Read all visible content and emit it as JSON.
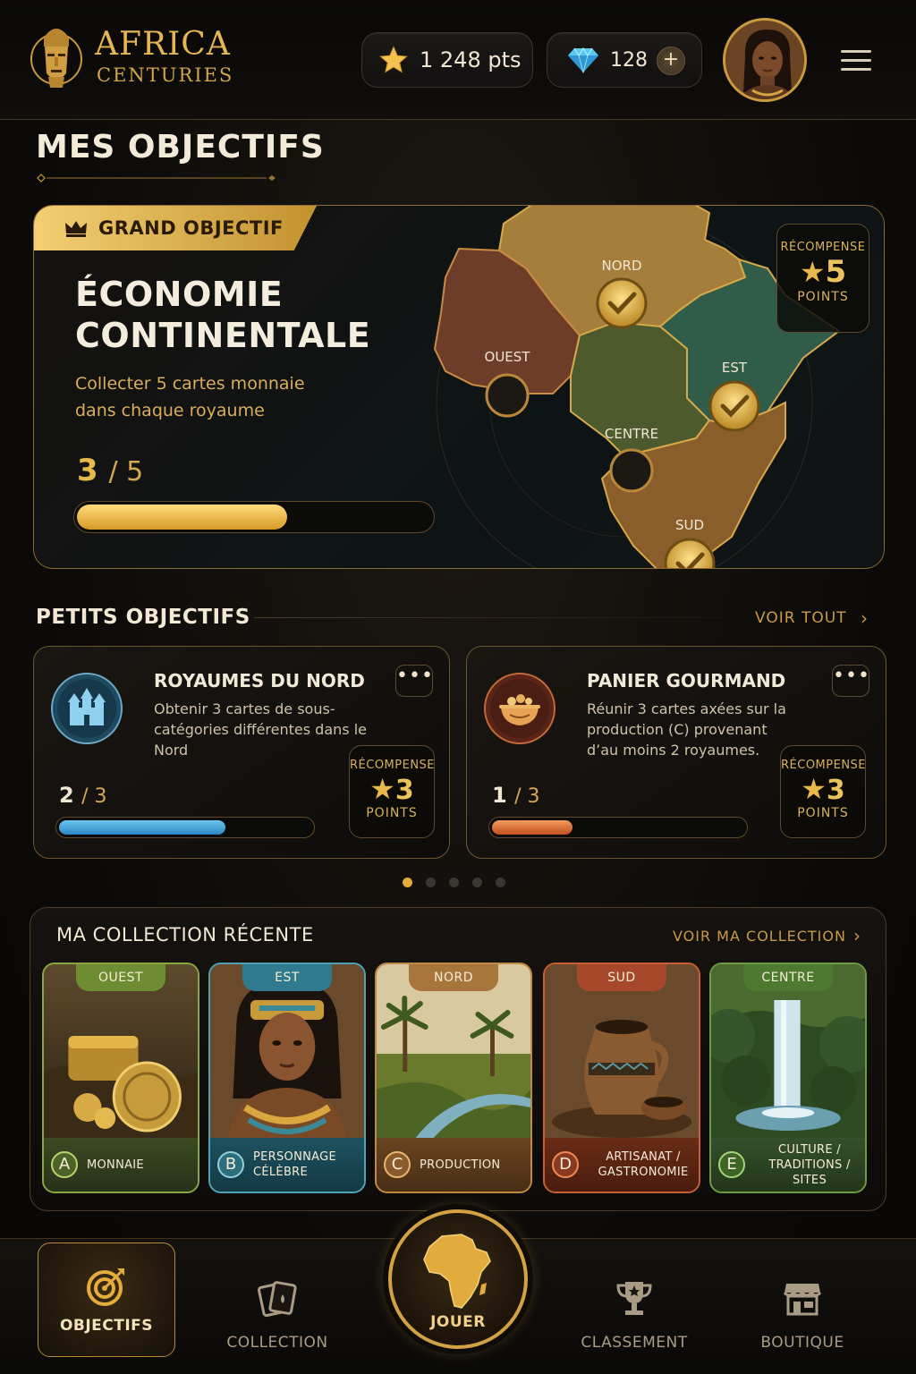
{
  "header": {
    "logo_title": "AFRICA",
    "logo_sub": "CENTURIES",
    "points": "1 248 pts",
    "gems": "128",
    "gem_add": "+",
    "icons": {
      "points": "star-icon",
      "gems": "diamond-icon",
      "menu": "hamburger-menu-icon"
    }
  },
  "page_title": "MES OBJECTIFS",
  "grand": {
    "badge": "GRAND OBJECTIF",
    "title": "ÉCONOMIE CONTINENTALE",
    "desc": "Collecter 5 cartes monnaie dans chaque royaume",
    "current": "3",
    "total": "/ 5",
    "progress": 0.6,
    "reward_label": "RÉCOMPENSE",
    "reward_value": "5",
    "reward_unit": "POINTS",
    "regions": [
      {
        "name": "NORD",
        "done": true
      },
      {
        "name": "OUEST",
        "done": false
      },
      {
        "name": "EST",
        "done": true
      },
      {
        "name": "CENTRE",
        "done": false
      },
      {
        "name": "SUD",
        "done": true
      }
    ]
  },
  "small": {
    "heading": "PETITS OBJECTIFS",
    "see_all": "VOIR TOUT",
    "more": "•••",
    "items": [
      {
        "title": "ROYAUMES DU NORD",
        "desc": "Obtenir 3 cartes de sous-catégories différentes dans le Nord",
        "current": "2",
        "total": "/ 3",
        "progress": 0.667,
        "reward_label": "RÉCOMPENSE",
        "reward_value": "3",
        "reward_unit": "POINTS",
        "icon": "castle-icon",
        "color": "#2c86c3"
      },
      {
        "title": "PANIER GOURMAND",
        "desc": "Réunir 3 cartes axées sur la production (C) provenant d’au moins 2 royaumes.",
        "current": "1",
        "total": "/ 3",
        "progress": 0.333,
        "reward_label": "RÉCOMPENSE",
        "reward_value": "3",
        "reward_unit": "POINTS",
        "icon": "food-bowl-icon",
        "color": "#c2501f"
      }
    ],
    "pages": 5,
    "active_page": 1
  },
  "collection": {
    "title": "MA COLLECTION RÉCENTE",
    "link": "VOIR MA COLLECTION",
    "cards": [
      {
        "region": "OUEST",
        "letter": "A",
        "category": "MONNAIE",
        "accent": "#7fa03a"
      },
      {
        "region": "EST",
        "letter": "B",
        "category": "PERSONNAGE CÉLÈBRE",
        "accent": "#3f8a9a"
      },
      {
        "region": "NORD",
        "letter": "C",
        "category": "PRODUCTION",
        "accent": "#b07a36"
      },
      {
        "region": "SUD",
        "letter": "D",
        "category": "ARTISANAT / GASTRONOMIE",
        "accent": "#b0502a"
      },
      {
        "region": "CENTRE",
        "letter": "E",
        "category": "CULTURE / TRADITIONS / SITES",
        "accent": "#5e8a3a"
      }
    ]
  },
  "nav": {
    "objectives": "OBJECTIFS",
    "collection": "COLLECTION",
    "play": "JOUER",
    "ranking": "CLASSEMENT",
    "shop": "BOUTIQUE"
  }
}
